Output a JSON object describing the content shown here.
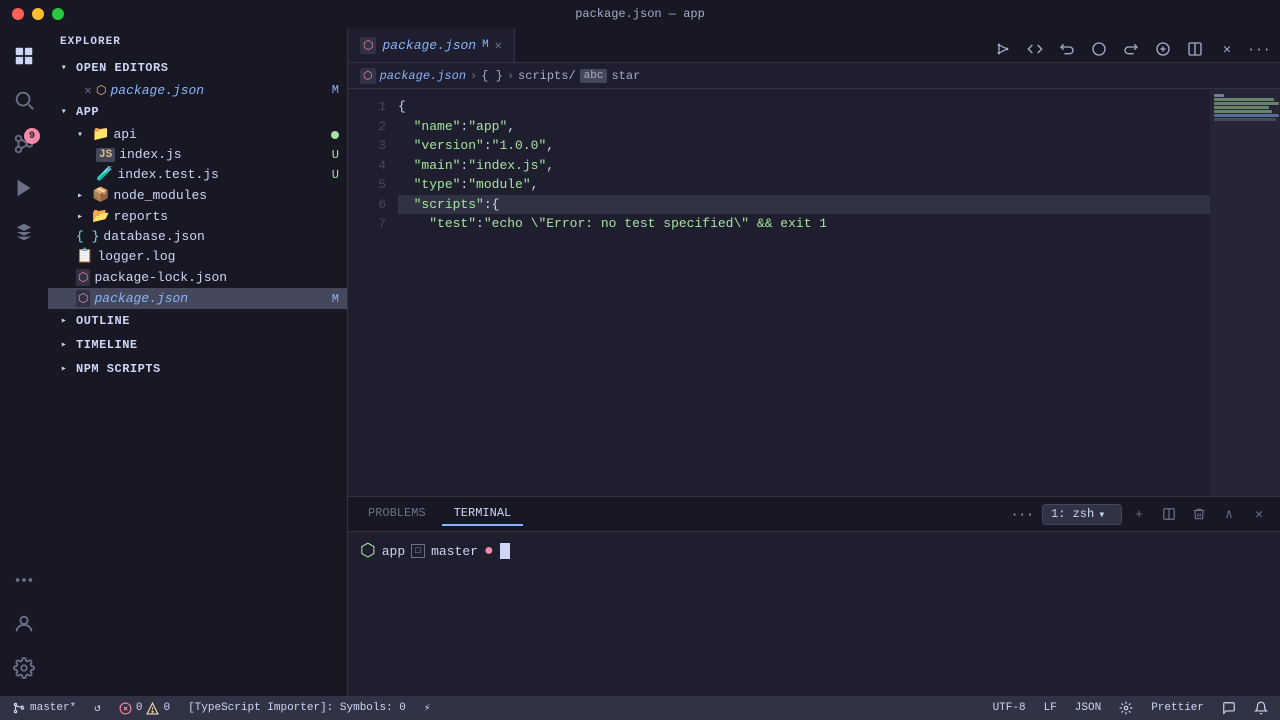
{
  "titlebar": {
    "title": "package.json — app"
  },
  "sidebar": {
    "header": "Explorer",
    "open_editors": {
      "label": "Open Editors",
      "files": [
        {
          "name": "package.json",
          "badge": "M",
          "active": true
        }
      ]
    },
    "app": {
      "label": "APP",
      "items": [
        {
          "name": "api",
          "type": "folder",
          "indent": 1,
          "expanded": true,
          "has_dot": true,
          "children": [
            {
              "name": "index.js",
              "type": "js",
              "indent": 2,
              "badge": "U"
            },
            {
              "name": "index.test.js",
              "type": "test",
              "indent": 2,
              "badge": "U"
            }
          ]
        },
        {
          "name": "node_modules",
          "type": "folder",
          "indent": 1,
          "expanded": false
        },
        {
          "name": "reports",
          "type": "folder",
          "indent": 1,
          "expanded": false
        },
        {
          "name": "database.json",
          "type": "json",
          "indent": 1
        },
        {
          "name": "logger.log",
          "type": "log",
          "indent": 1
        },
        {
          "name": "package-lock.json",
          "type": "pkglock",
          "indent": 1
        },
        {
          "name": "package.json",
          "type": "pkg",
          "indent": 1,
          "badge": "M",
          "selected": true
        }
      ]
    },
    "outline": {
      "label": "Outline"
    },
    "timeline": {
      "label": "Timeline"
    },
    "npm_scripts": {
      "label": "NPM Scripts"
    }
  },
  "editor": {
    "tab": {
      "icon": "JSON",
      "name": "package.json",
      "badge": "M"
    },
    "breadcrumb": {
      "file": "package.json",
      "path1": "{ }",
      "path2": "scripts/",
      "path3": "abc",
      "path4": "star"
    },
    "lines": [
      {
        "num": 1,
        "content": "{"
      },
      {
        "num": 2,
        "content": "  \"name\": \"app\","
      },
      {
        "num": 3,
        "content": "  \"version\": \"1.0.0\","
      },
      {
        "num": 4,
        "content": "  \"main\": \"index.js\","
      },
      {
        "num": 5,
        "content": "  \"type\": \"module\","
      },
      {
        "num": 6,
        "content": "  \"scripts\": {"
      },
      {
        "num": 7,
        "content": "    \"test\": \"echo \\\"Error: no test specified\\\" && exit 1"
      }
    ]
  },
  "terminal": {
    "tabs": [
      {
        "label": "PROBLEMS",
        "active": false
      },
      {
        "label": "TERMINAL",
        "active": true
      }
    ],
    "shell": "1: zsh",
    "prompt": {
      "gem": "⬡",
      "app": "app",
      "git_icon": "□",
      "branch": "master",
      "dot": "●"
    },
    "more_btn": "···"
  },
  "statusbar": {
    "git_branch": "master*",
    "sync_icon": "↺",
    "errors": "0",
    "warnings": "0",
    "importer": "[TypeScript Importer]: Symbols: 0",
    "location_icon": "⚡",
    "encoding": "UTF-8",
    "line_ending": "LF",
    "language": "JSON",
    "formatter": "Prettier",
    "feedback_icon": "🗨",
    "bell_icon": "🔔"
  },
  "activity_bar": {
    "icons": [
      {
        "name": "explorer-icon",
        "label": "Explorer",
        "active": true
      },
      {
        "name": "search-icon",
        "label": "Search"
      },
      {
        "name": "source-control-icon",
        "label": "Source Control",
        "badge": "9"
      },
      {
        "name": "run-debug-icon",
        "label": "Run and Debug"
      },
      {
        "name": "extensions-icon",
        "label": "Extensions"
      },
      {
        "name": "more-icon",
        "label": "More"
      }
    ],
    "bottom_icons": [
      {
        "name": "accounts-icon",
        "label": "Accounts"
      },
      {
        "name": "settings-icon",
        "label": "Settings"
      }
    ]
  }
}
